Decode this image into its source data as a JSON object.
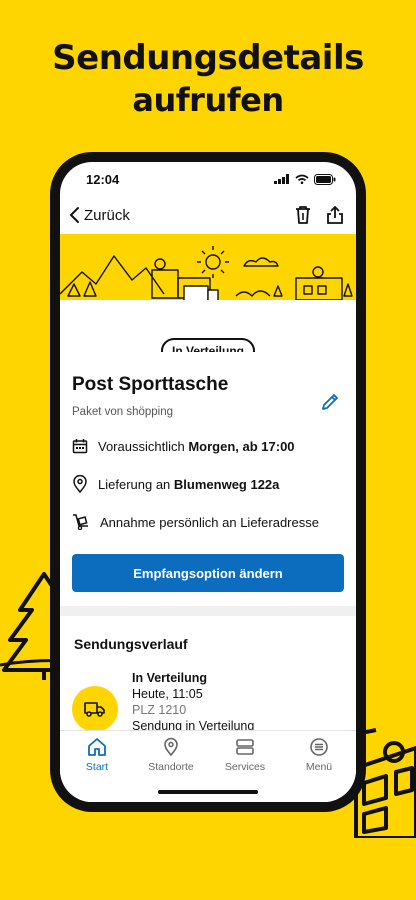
{
  "colors": {
    "brand_yellow": "#FFD500",
    "accent_blue": "#0C6DBE",
    "ink": "#111111"
  },
  "headline": {
    "line1": "Sendungsdetails",
    "line2": "aufrufen"
  },
  "statusbar": {
    "time": "12:04",
    "icons": [
      "signal-icon",
      "wifi-icon",
      "battery-icon"
    ]
  },
  "nav": {
    "back_label": "Zurück",
    "actions": [
      "trash-icon",
      "share-icon"
    ]
  },
  "shipment": {
    "status_badge": "In Verteilung",
    "title": "Post Sporttasche",
    "subtitle": "Paket von shöpping",
    "eta_prefix": "Voraussichtlich ",
    "eta_value": "Morgen, ab 17:00",
    "delivery_prefix": "Lieferung an ",
    "delivery_address": "Blumenweg 122a",
    "acceptance": "Annahme persönlich an Lieferadresse",
    "cta_label": "Empfangsoption ändern"
  },
  "history": {
    "title": "Sendungsverlauf",
    "items": [
      {
        "status": "In Verteilung",
        "time": "Heute, 11:05",
        "plz": "PLZ 1210",
        "description": "Sendung in Verteilung"
      }
    ]
  },
  "tabs": [
    {
      "label": "Start",
      "icon": "home-icon",
      "active": true
    },
    {
      "label": "Standorte",
      "icon": "map-pin-icon",
      "active": false
    },
    {
      "label": "Services",
      "icon": "services-icon",
      "active": false
    },
    {
      "label": "Menü",
      "icon": "menu-icon",
      "active": false
    }
  ]
}
